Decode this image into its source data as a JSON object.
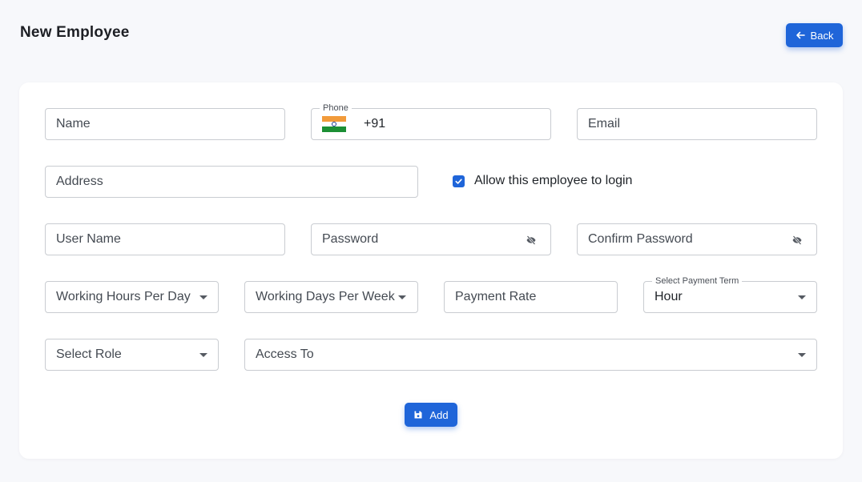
{
  "header": {
    "title": "New Employee",
    "back_label": "Back"
  },
  "form": {
    "name": {
      "placeholder": "Name"
    },
    "phone": {
      "label": "Phone",
      "value": "+91",
      "flag": "india-flag-icon"
    },
    "email": {
      "placeholder": "Email"
    },
    "address": {
      "placeholder": "Address"
    },
    "allow_login": {
      "label": "Allow this employee to login",
      "checked": true
    },
    "username": {
      "placeholder": "User Name"
    },
    "password": {
      "placeholder": "Password"
    },
    "confirm_password": {
      "placeholder": "Confirm Password"
    },
    "working_hours": {
      "placeholder": "Working Hours Per Day"
    },
    "working_days": {
      "placeholder": "Working Days Per Week"
    },
    "payment_rate": {
      "placeholder": "Payment Rate"
    },
    "payment_term": {
      "label": "Select Payment Term",
      "value": "Hour"
    },
    "role": {
      "placeholder": "Select Role"
    },
    "access_to": {
      "placeholder": "Access To"
    },
    "add_label": "Add"
  },
  "colors": {
    "primary": "#1f65d9",
    "border": "#c9ccd1",
    "background": "#f7f8fb"
  }
}
